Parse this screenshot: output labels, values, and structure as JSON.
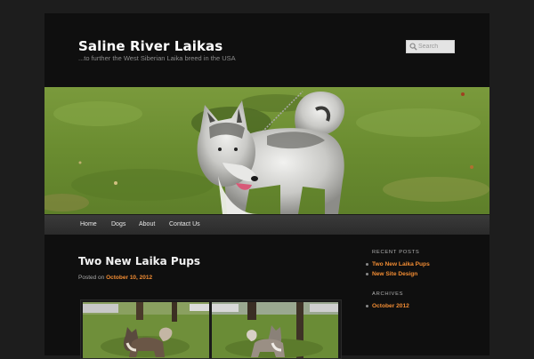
{
  "site": {
    "title": "Saline River Laikas",
    "description": "...to further the West Siberian Laika breed in the USA"
  },
  "search": {
    "placeholder": "Search",
    "icon": "search-icon"
  },
  "nav": {
    "items": [
      {
        "label": "Home"
      },
      {
        "label": "Dogs"
      },
      {
        "label": "About"
      },
      {
        "label": "Contact Us"
      }
    ]
  },
  "post": {
    "title": "Two New Laika Pups",
    "posted_on": "Posted on",
    "date": "October 10, 2012"
  },
  "sidebar": {
    "recent_posts": {
      "title": "RECENT POSTS",
      "items": [
        {
          "label": "Two New Laika Pups"
        },
        {
          "label": "New Site Design"
        }
      ]
    },
    "archives": {
      "title": "ARCHIVES",
      "items": [
        {
          "label": "October 2012"
        }
      ]
    }
  },
  "colors": {
    "accent": "#f18c33",
    "page_bg": "#0f0f0f",
    "body_bg": "#1d1d1d"
  }
}
